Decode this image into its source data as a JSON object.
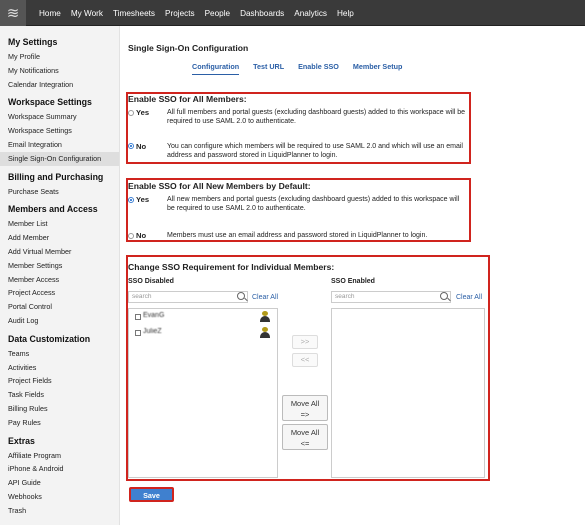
{
  "topnav": {
    "logo_icon": "logo-icon",
    "items": [
      "Home",
      "My Work",
      "Timesheets",
      "Projects",
      "People",
      "Dashboards",
      "Analytics",
      "Help"
    ]
  },
  "sidebar": {
    "sections": [
      {
        "title": "My Settings",
        "items": [
          "My Profile",
          "My Notifications",
          "Calendar Integration"
        ]
      },
      {
        "title": "Workspace Settings",
        "items": [
          "Workspace Summary",
          "Workspace Settings",
          "Email Integration",
          "Single Sign-On Configuration"
        ]
      },
      {
        "title": "Billing and Purchasing",
        "items": [
          "Purchase Seats"
        ]
      },
      {
        "title": "Members and Access",
        "items": [
          "Member List",
          "Add Member",
          "Add Virtual Member",
          "Member Settings",
          "Member Access",
          "Project Access",
          "Portal Control",
          "Audit Log"
        ]
      },
      {
        "title": "Data Customization",
        "items": [
          "Teams",
          "Activities",
          "Project Fields",
          "Task Fields",
          "Billing Rules",
          "Pay Rules"
        ]
      },
      {
        "title": "Extras",
        "items": [
          "Affiliate Program",
          "iPhone & Android",
          "API Guide",
          "Webhooks",
          "Trash"
        ]
      }
    ],
    "active_item": "Single Sign-On Configuration"
  },
  "page": {
    "title": "Single Sign-On Configuration",
    "tabs": [
      "Configuration",
      "Test URL",
      "Enable SSO",
      "Member Setup"
    ],
    "active_tab": "Configuration"
  },
  "enable_all": {
    "title": "Enable SSO for All Members:",
    "yes_label": "Yes",
    "yes_desc": "All full members and portal guests (excluding dashboard guests) added to this workspace will be required to use SAML 2.0 to authenticate.",
    "no_label": "No",
    "no_desc": "You can configure which members will be required to use SAML 2.0 and which will use an email address and password stored in LiquidPlanner to login.",
    "selected": "No"
  },
  "enable_new": {
    "title": "Enable SSO for All New Members by Default:",
    "yes_label": "Yes",
    "yes_desc": "All new members and portal guests (excluding dashboard guests) added to this workspace will be required to use SAML 2.0 to authenticate.",
    "no_label": "No",
    "no_desc": "Members must use an email address and password stored in LiquidPlanner to login.",
    "selected": "Yes"
  },
  "individual": {
    "title": "Change SSO Requirement for Individual Members:",
    "disabled_label": "SSO Disabled",
    "enabled_label": "SSO Enabled",
    "search_placeholder": "search",
    "clear_all": "Clear All",
    "disabled_members": [
      "EvanG",
      "JulieZ"
    ],
    "enabled_members": [],
    "move_right": ">>",
    "move_left": "<<",
    "move_all_label": "Move All",
    "move_all_right_arrow": "=>",
    "move_all_left_arrow": "<="
  },
  "save_label": "Save",
  "colors": {
    "topbar": "#3a3a3a",
    "accent": "#2b5fa6",
    "highlight": "#d0241e",
    "save": "#3f80cf"
  }
}
